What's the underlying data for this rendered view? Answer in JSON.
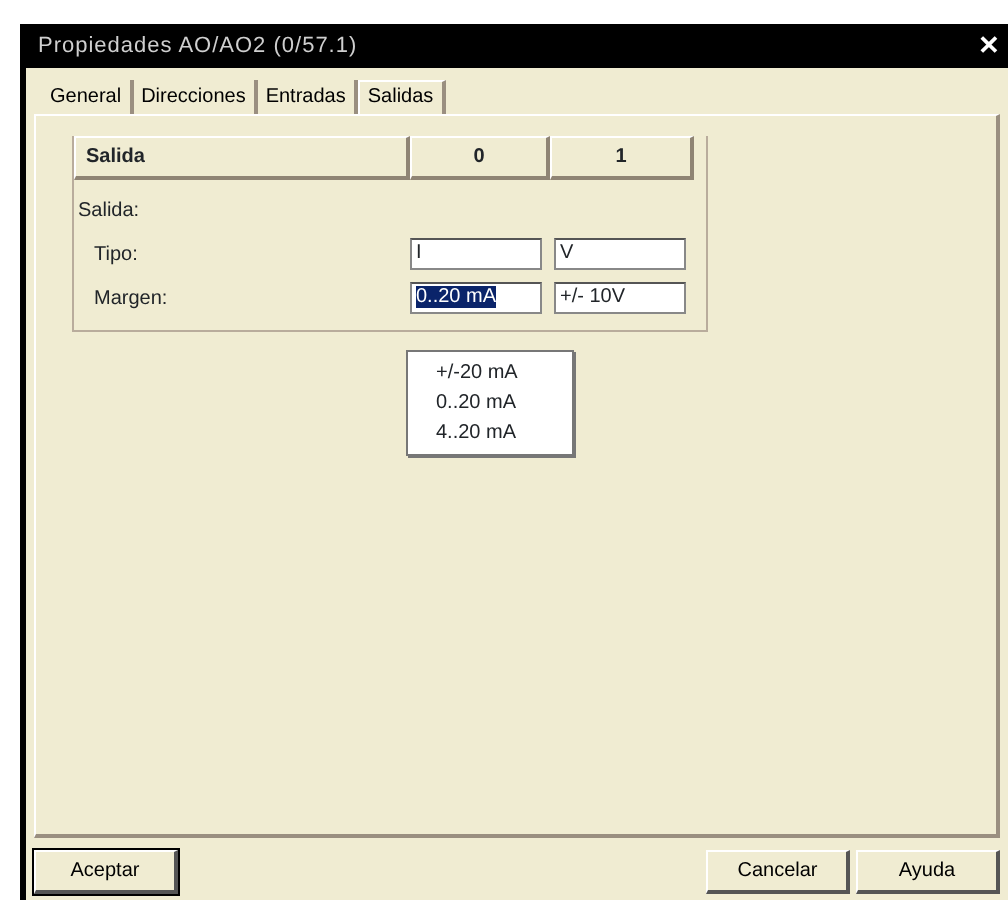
{
  "window": {
    "title": "Propiedades  AO/AO2  (0/57.1)",
    "close": "✕"
  },
  "tabs": [
    {
      "label": "General",
      "selected": false
    },
    {
      "label": "Direcciones",
      "selected": false
    },
    {
      "label": "Entradas",
      "selected": false
    },
    {
      "label": "Salidas",
      "selected": true
    }
  ],
  "table": {
    "columns": [
      "Salida",
      "0",
      "1"
    ]
  },
  "section_label": "Salida:",
  "rows": [
    {
      "label": "Tipo:",
      "values": [
        {
          "value": "I",
          "selected": false
        },
        {
          "value": "V",
          "selected": false
        }
      ]
    },
    {
      "label": "Margen:",
      "values": [
        {
          "value": "0..20 mA",
          "selected": true
        },
        {
          "value": "+/- 10V",
          "selected": false
        }
      ]
    }
  ],
  "dropdown": {
    "options": [
      "+/-20 mA",
      "0..20 mA",
      "4..20 mA"
    ]
  },
  "buttons": {
    "left": [
      "Aceptar"
    ],
    "right": [
      "Cancelar",
      "Ayuda"
    ]
  }
}
